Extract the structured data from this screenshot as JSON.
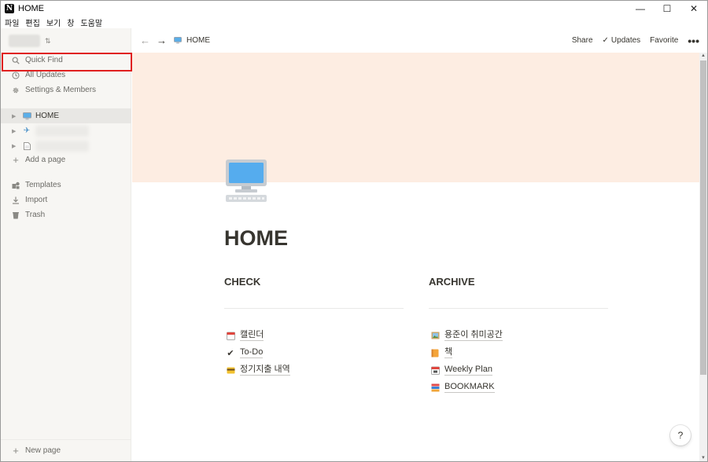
{
  "window": {
    "title": "HOME"
  },
  "menu": [
    "파일",
    "편집",
    "보기",
    "창",
    "도움말"
  ],
  "sidebar": {
    "utility": [
      {
        "label": "Quick Find",
        "icon": "search-icon"
      },
      {
        "label": "All Updates",
        "icon": "clock-icon"
      },
      {
        "label": "Settings & Members",
        "icon": "gear-icon"
      }
    ],
    "pages": [
      {
        "label": "HOME",
        "icon": "computer-icon"
      },
      {
        "label": "",
        "icon": "airplane-icon"
      },
      {
        "label": "",
        "icon": "document-icon"
      }
    ],
    "add_page": "Add a page",
    "tools": [
      {
        "label": "Templates",
        "icon": "templates-icon"
      },
      {
        "label": "Import",
        "icon": "download-icon"
      },
      {
        "label": "Trash",
        "icon": "trash-icon"
      }
    ],
    "new_page": "New page"
  },
  "topbar": {
    "breadcrumb": "HOME",
    "share": "Share",
    "updates": "Updates",
    "favorite": "Favorite"
  },
  "page": {
    "title": "HOME",
    "cover_color": "#fdede2",
    "columns": [
      {
        "heading": "CHECK",
        "links": [
          {
            "label": "캘린더",
            "icon": "calendar-icon"
          },
          {
            "label": "To-Do",
            "icon": "checkmark-icon"
          },
          {
            "label": "정기지출 내역",
            "icon": "credit-card-icon"
          }
        ]
      },
      {
        "heading": "ARCHIVE",
        "links": [
          {
            "label": "용준이 취미공간",
            "icon": "framed-picture-icon"
          },
          {
            "label": "책",
            "icon": "book-icon"
          },
          {
            "label": "Weekly Plan",
            "icon": "calendar-icon"
          },
          {
            "label": "BOOKMARK",
            "icon": "books-icon"
          }
        ]
      }
    ]
  },
  "help": "?"
}
